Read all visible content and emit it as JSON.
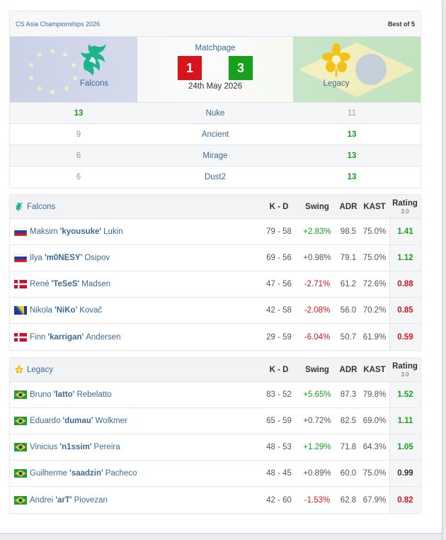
{
  "match": {
    "event": "CS Asia Championships 2026",
    "format": "Best of 5",
    "matchpage_link": "Matchpage",
    "date": "24th May 2026",
    "team1": {
      "name": "Falcons",
      "score": "1"
    },
    "team2": {
      "name": "Legacy",
      "score": "3"
    },
    "maps": [
      {
        "name": "Nuke",
        "t1": "13",
        "t2": "11",
        "winner": "t1"
      },
      {
        "name": "Ancient",
        "t1": "9",
        "t2": "13",
        "winner": "t2"
      },
      {
        "name": "Mirage",
        "t1": "6",
        "t2": "13",
        "winner": "t2"
      },
      {
        "name": "Dust2",
        "t1": "6",
        "t2": "13",
        "winner": "t2"
      }
    ],
    "colors": {
      "win": "#15a21a",
      "lose": "#d8141a",
      "link": "#3b6a9a"
    }
  },
  "stats": {
    "headers": {
      "kd": "K - D",
      "swing": "Swing",
      "adr": "ADR",
      "kast": "KAST",
      "rating": "Rating",
      "rating_ver": "3.0"
    },
    "teams": [
      {
        "name": "Falcons",
        "logo_icon": "falcons-logo-icon",
        "players": [
          {
            "flag": "ru",
            "first": "Maksim",
            "nick": "'kyousuke'",
            "last": "Lukin",
            "kd": "79 - 58",
            "swing": "+2.83%",
            "swing_dir": "pos",
            "adr": "98.5",
            "kast": "75.0%",
            "rating": "1.41",
            "rating_class": "hi"
          },
          {
            "flag": "ru",
            "first": "Ilya",
            "nick": "'m0NESY'",
            "last": "Osipov",
            "kd": "69 - 56",
            "swing": "+0.98%",
            "swing_dir": "neu",
            "adr": "79.1",
            "kast": "75.0%",
            "rating": "1.12",
            "rating_class": "hi"
          },
          {
            "flag": "dk",
            "first": "René",
            "nick": "'TeSeS'",
            "last": "Madsen",
            "kd": "47 - 56",
            "swing": "-2.71%",
            "swing_dir": "neg",
            "adr": "61.2",
            "kast": "72.6%",
            "rating": "0.88",
            "rating_class": "lo"
          },
          {
            "flag": "ba",
            "first": "Nikola",
            "nick": "'NiKo'",
            "last": "Kovač",
            "kd": "42 - 58",
            "swing": "-2.08%",
            "swing_dir": "neg",
            "adr": "56.0",
            "kast": "70.2%",
            "rating": "0.85",
            "rating_class": "lo"
          },
          {
            "flag": "dk",
            "first": "Finn",
            "nick": "'karrigan'",
            "last": "Andersen",
            "kd": "29 - 59",
            "swing": "-6.04%",
            "swing_dir": "neg",
            "adr": "50.7",
            "kast": "61.9%",
            "rating": "0.59",
            "rating_class": "lo"
          }
        ]
      },
      {
        "name": "Legacy",
        "logo_icon": "legacy-logo-icon",
        "players": [
          {
            "flag": "br",
            "first": "Bruno",
            "nick": "'latto'",
            "last": "Rebelatto",
            "kd": "83 - 52",
            "swing": "+5.65%",
            "swing_dir": "pos",
            "adr": "87.3",
            "kast": "79.8%",
            "rating": "1.52",
            "rating_class": "hi"
          },
          {
            "flag": "br",
            "first": "Eduardo",
            "nick": "'dumau'",
            "last": "Wolkmer",
            "kd": "65 - 59",
            "swing": "+0.72%",
            "swing_dir": "neu",
            "adr": "82.5",
            "kast": "69.0%",
            "rating": "1.11",
            "rating_class": "hi"
          },
          {
            "flag": "br",
            "first": "Vinicius",
            "nick": "'n1ssim'",
            "last": "Pereira",
            "kd": "48 - 53",
            "swing": "+1.29%",
            "swing_dir": "pos",
            "adr": "71.8",
            "kast": "64.3%",
            "rating": "1.05",
            "rating_class": "hi"
          },
          {
            "flag": "br",
            "first": "Guilherme",
            "nick": "'saadzin'",
            "last": "Pacheco",
            "kd": "48 - 45",
            "swing": "+0.89%",
            "swing_dir": "neu",
            "adr": "60.0",
            "kast": "75.0%",
            "rating": "0.99",
            "rating_class": "mid"
          },
          {
            "flag": "br",
            "first": "Andrei",
            "nick": "'arT'",
            "last": "Piovezan",
            "kd": "42 - 60",
            "swing": "-1.53%",
            "swing_dir": "neg",
            "adr": "62.8",
            "kast": "67.9%",
            "rating": "0.82",
            "rating_class": "lo"
          }
        ]
      }
    ]
  }
}
